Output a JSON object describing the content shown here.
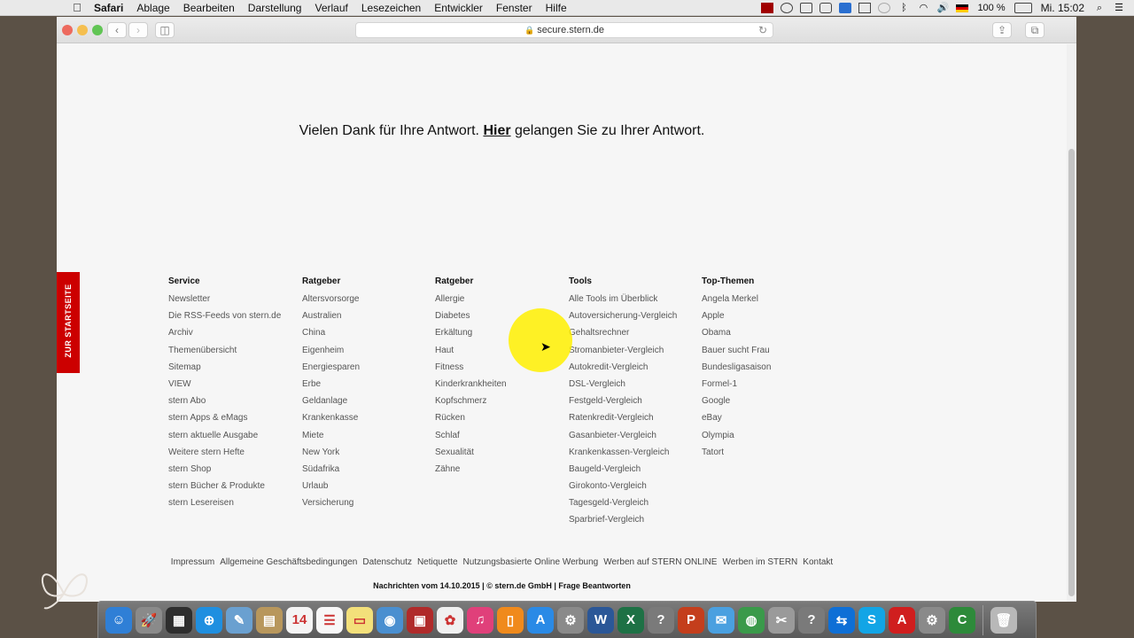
{
  "menubar": {
    "app": "Safari",
    "items": [
      "Ablage",
      "Bearbeiten",
      "Darstellung",
      "Verlauf",
      "Lesezeichen",
      "Entwickler",
      "Fenster",
      "Hilfe"
    ],
    "battery": "100 %",
    "clock": "Mi. 15:02"
  },
  "browser": {
    "url": "secure.stern.de"
  },
  "page": {
    "thanks_before": "Vielen Dank für Ihre Antwort. ",
    "thanks_link": "Hier",
    "thanks_after": " gelangen Sie zu Ihrer Antwort.",
    "side_tab": "ZUR STARTSEITE"
  },
  "footer": {
    "columns": [
      {
        "heading": "Service",
        "links": [
          "Newsletter",
          "Die RSS-Feeds von stern.de",
          "Archiv",
          "Themenübersicht",
          "Sitemap",
          "VIEW",
          "stern Abo",
          "stern Apps & eMags",
          "stern aktuelle Ausgabe",
          "Weitere stern Hefte",
          "stern Shop",
          "stern Bücher & Produkte",
          "stern Lesereisen"
        ]
      },
      {
        "heading": "Ratgeber",
        "links": [
          "Altersvorsorge",
          "Australien",
          "China",
          "Eigenheim",
          "Energiesparen",
          "Erbe",
          "Geldanlage",
          "Krankenkasse",
          "Miete",
          "New York",
          "Südafrika",
          "Urlaub",
          "Versicherung"
        ]
      },
      {
        "heading": "Ratgeber",
        "links": [
          "Allergie",
          "Diabetes",
          "Erkältung",
          "Haut",
          "Fitness",
          "Kinderkrankheiten",
          "Kopfschmerz",
          "Rücken",
          "Schlaf",
          "Sexualität",
          "Zähne"
        ]
      },
      {
        "heading": "Tools",
        "links": [
          "Alle Tools im Überblick",
          "Autoversicherung-Vergleich",
          "Gehaltsrechner",
          "Stromanbieter-Vergleich",
          "Autokredit-Vergleich",
          "DSL-Vergleich",
          "Festgeld-Vergleich",
          "Ratenkredit-Vergleich",
          "Gasanbieter-Vergleich",
          "Krankenkassen-Vergleich",
          "Baugeld-Vergleich",
          "Girokonto-Vergleich",
          "Tagesgeld-Vergleich",
          "Sparbrief-Vergleich"
        ]
      },
      {
        "heading": "Top-Themen",
        "links": [
          "Angela Merkel",
          "Apple",
          "Obama",
          "Bauer sucht Frau",
          "Bundesligasaison",
          "Formel-1",
          "Google",
          "eBay",
          "Olympia",
          "Tatort"
        ]
      }
    ],
    "legal_links": [
      "Impressum",
      "Allgemeine Geschäftsbedingungen",
      "Datenschutz",
      "Netiquette",
      "Nutzungsbasierte Online Werbung",
      "Werben auf STERN ONLINE",
      "Werben im STERN",
      "Kontakt"
    ],
    "copyright": "Nachrichten vom 14.10.2015 | © stern.de GmbH | Frage Beantworten"
  },
  "dock": {
    "calendar_day": "14",
    "items": [
      {
        "icon": "finder-icon",
        "color": "#2f7fd6",
        "glyph": "☺"
      },
      {
        "icon": "launchpad-icon",
        "color": "#8a8a8a",
        "glyph": "🚀"
      },
      {
        "icon": "mission-control-icon",
        "color": "#2e2e2e",
        "glyph": "▦"
      },
      {
        "icon": "safari-icon",
        "color": "#1f8fe0",
        "glyph": "⊕"
      },
      {
        "icon": "preview-icon",
        "color": "#6aa0d0",
        "glyph": "✎"
      },
      {
        "icon": "notes-icon",
        "color": "#b8975c",
        "glyph": "▤"
      },
      {
        "icon": "calendar-icon",
        "color": "#f4f4f4",
        "glyph": "14"
      },
      {
        "icon": "reminders-icon",
        "color": "#f7f7f7",
        "glyph": "☰"
      },
      {
        "icon": "stickies-icon",
        "color": "#f3e07a",
        "glyph": "▭"
      },
      {
        "icon": "photo-booth-icon",
        "color": "#4a8fd0",
        "glyph": "◉"
      },
      {
        "icon": "photo-app-icon",
        "color": "#b02a2a",
        "glyph": "▣"
      },
      {
        "icon": "photos-icon",
        "color": "#f0f0f0",
        "glyph": "✿"
      },
      {
        "icon": "itunes-icon",
        "color": "#e0407a",
        "glyph": "♫"
      },
      {
        "icon": "ibooks-icon",
        "color": "#f08a1c",
        "glyph": "▯"
      },
      {
        "icon": "app-store-icon",
        "color": "#2a8ae6",
        "glyph": "A"
      },
      {
        "icon": "system-preferences-icon",
        "color": "#8a8a8a",
        "glyph": "⚙"
      },
      {
        "icon": "word-icon",
        "color": "#2b5797",
        "glyph": "W"
      },
      {
        "icon": "excel-icon",
        "color": "#1e7145",
        "glyph": "X"
      },
      {
        "icon": "help-icon",
        "color": "#7a7a7a",
        "glyph": "?"
      },
      {
        "icon": "powerpoint-icon",
        "color": "#c43e1c",
        "glyph": "P"
      },
      {
        "icon": "messenger-icon",
        "color": "#4aa0e0",
        "glyph": "✉"
      },
      {
        "icon": "network-icon",
        "color": "#3a9a4a",
        "glyph": "◍"
      },
      {
        "icon": "utility-icon",
        "color": "#9a9a9a",
        "glyph": "✂"
      },
      {
        "icon": "help-icon-2",
        "color": "#7a7a7a",
        "glyph": "?"
      },
      {
        "icon": "teamviewer-icon",
        "color": "#0e6fd6",
        "glyph": "⇆"
      },
      {
        "icon": "skype-icon",
        "color": "#12a5e6",
        "glyph": "S"
      },
      {
        "icon": "acrobat-icon",
        "color": "#d01e1e",
        "glyph": "A"
      },
      {
        "icon": "compressor-icon",
        "color": "#8a8a8a",
        "glyph": "⚙"
      },
      {
        "icon": "camtasia-icon",
        "color": "#2d8a3a",
        "glyph": "C"
      },
      {
        "icon": "trash-icon",
        "color": "#b8b8b8",
        "glyph": "🗑"
      }
    ]
  }
}
